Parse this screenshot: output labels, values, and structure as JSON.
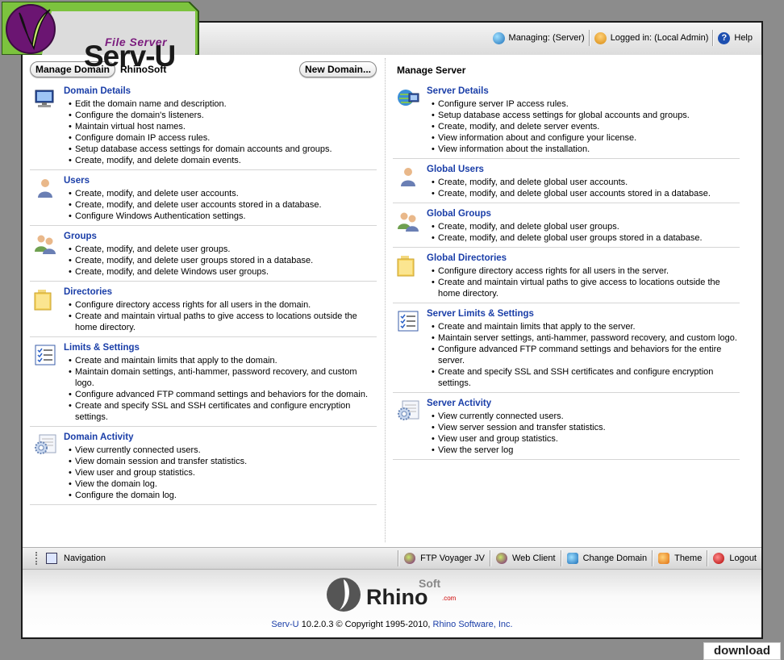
{
  "header": {
    "product_small": "File Server",
    "product_big": "Serv-U",
    "managing": "Managing: (Server)",
    "logged_in": "Logged in: (Local Admin)",
    "help": "Help"
  },
  "left": {
    "manage_domain_label": "Manage Domain",
    "domain_name": "RhinoSoft",
    "new_domain_label": "New Domain...",
    "sections": [
      {
        "title": "Domain Details",
        "items": [
          "Edit the domain name and description.",
          "Configure the domain's listeners.",
          "Maintain virtual host names.",
          "Configure domain IP access rules.",
          "Setup database access settings for domain accounts and groups.",
          "Create, modify, and delete domain events."
        ]
      },
      {
        "title": "Users",
        "items": [
          "Create, modify, and delete user accounts.",
          "Create, modify, and delete user accounts stored in a database.",
          "Configure Windows Authentication settings."
        ]
      },
      {
        "title": "Groups",
        "items": [
          "Create, modify, and delete user groups.",
          "Create, modify, and delete user groups stored in a database.",
          "Create, modify, and delete Windows user groups."
        ]
      },
      {
        "title": "Directories",
        "items": [
          "Configure directory access rights for all users in the domain.",
          "Create and maintain virtual paths to give access to locations outside the home directory."
        ]
      },
      {
        "title": "Limits & Settings",
        "items": [
          "Create and maintain limits that apply to the domain.",
          "Maintain domain settings, anti-hammer, password recovery, and custom logo.",
          "Configure advanced FTP command settings and behaviors for the domain.",
          "Create and specify SSL and SSH certificates and configure encryption settings."
        ]
      },
      {
        "title": "Domain Activity",
        "items": [
          "View currently connected users.",
          "View domain session and transfer statistics.",
          "View user and group statistics.",
          "View the domain log.",
          "Configure the domain log."
        ]
      }
    ]
  },
  "right": {
    "title": "Manage Server",
    "sections": [
      {
        "title": "Server Details",
        "items": [
          "Configure server IP access rules.",
          "Setup database access settings for global accounts and groups.",
          "Create, modify, and delete server events.",
          "View information about and configure your license.",
          "View information about the installation."
        ]
      },
      {
        "title": "Global Users",
        "items": [
          "Create, modify, and delete global user accounts.",
          "Create, modify, and delete global user accounts stored in a database."
        ]
      },
      {
        "title": "Global Groups",
        "items": [
          "Create, modify, and delete global user groups.",
          "Create, modify, and delete global user groups stored in a database."
        ]
      },
      {
        "title": "Global Directories",
        "items": [
          "Configure directory access rights for all users in the server.",
          "Create and maintain virtual paths to give access to locations outside the home directory."
        ]
      },
      {
        "title": "Server Limits & Settings",
        "items": [
          "Create and maintain limits that apply to the server.",
          "Maintain server settings, anti-hammer, password recovery, and custom logo.",
          "Configure advanced FTP command settings and behaviors for the entire server.",
          "Create and specify SSL and SSH certificates and configure encryption settings."
        ]
      },
      {
        "title": "Server Activity",
        "items": [
          "View currently connected users.",
          "View server session and transfer statistics.",
          "View user and group statistics.",
          "View the server log"
        ]
      }
    ]
  },
  "navbar": {
    "navigation": "Navigation",
    "ftp_voyager": "FTP Voyager JV",
    "web_client": "Web Client",
    "change_domain": "Change Domain",
    "theme": "Theme",
    "logout": "Logout"
  },
  "footer": {
    "rhino_text": "Rhino",
    "soft_text": "Soft",
    "com_text": ".com",
    "product_link": "Serv-U",
    "copyright_text": " 10.2.0.3 © Copyright 1995-2010, ",
    "company_link": "Rhino Software, Inc.",
    "watermark": "download"
  },
  "icons": {
    "section_left": [
      "monitor-icon",
      "user-icon",
      "group-icon",
      "folder-icon",
      "checklist-icon",
      "gear-icon"
    ],
    "section_right": [
      "server-icon",
      "user-icon",
      "group-icon",
      "folder-icon",
      "checklist-icon",
      "gear-icon"
    ]
  }
}
